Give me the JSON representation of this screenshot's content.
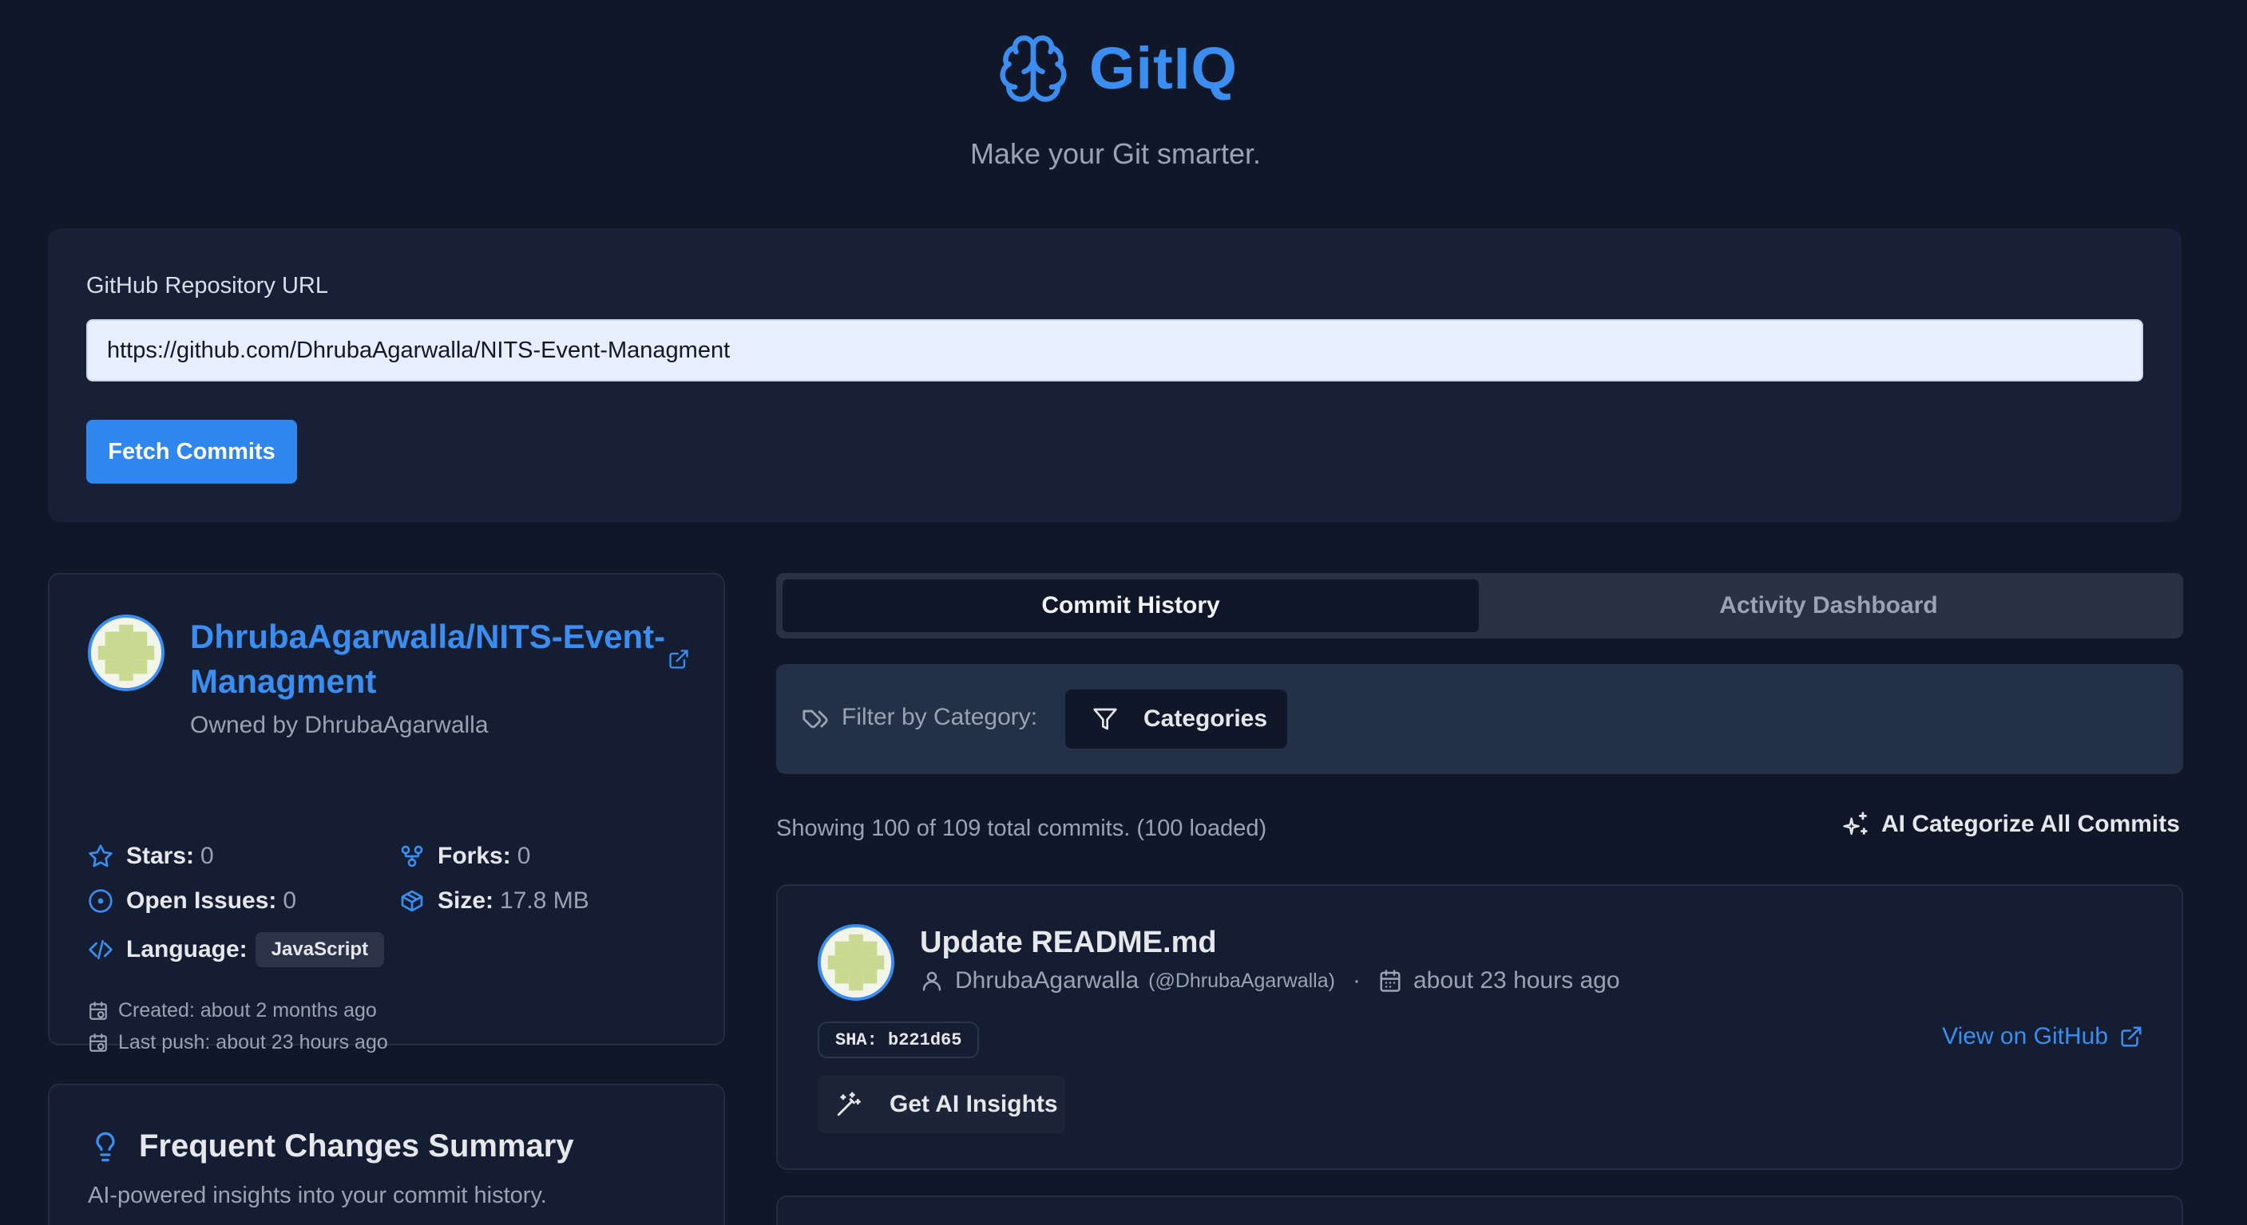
{
  "app": {
    "title": "GitIQ",
    "tagline": "Make your Git smarter.",
    "brand_color": "#3b8ef0",
    "logo_icon": "brain-icon"
  },
  "url_form": {
    "label": "GitHub Repository URL",
    "value": "https://github.com/DhrubaAgarwalla/NITS-Event-Managment",
    "submit_label": "Fetch Commits"
  },
  "repo": {
    "name": "DhrubaAgarwalla/NITS-Event-Managment",
    "owner_text": "Owned by DhrubaAgarwalla",
    "stats": {
      "stars_label": "Stars:",
      "stars_value": "0",
      "forks_label": "Forks:",
      "forks_value": "0",
      "issues_label": "Open Issues:",
      "issues_value": "0",
      "size_label": "Size:",
      "size_value": "17.8 MB",
      "language_label": "Language:",
      "language_value": "JavaScript"
    },
    "created": "Created: about 2 months ago",
    "last_push": "Last push: about 23 hours ago"
  },
  "summary": {
    "title": "Frequent Changes Summary",
    "subtitle": "AI-powered insights into your commit history."
  },
  "tabs": [
    {
      "label": "Commit History",
      "active": true
    },
    {
      "label": "Activity Dashboard",
      "active": false
    }
  ],
  "filter": {
    "label": "Filter by Category:",
    "button_label": "Categories"
  },
  "commits_info": {
    "showing_text": "Showing 100 of 109 total commits. (100 loaded)",
    "ai_categorize_label": "AI Categorize All Commits"
  },
  "commits": [
    {
      "title": "Update README.md",
      "author": "DhrubaAgarwalla",
      "handle": "(@DhrubaAgarwalla)",
      "separator": "·",
      "time": "about 23 hours ago",
      "sha": "SHA: b221d65",
      "view_label": "View on GitHub",
      "insights_label": "Get AI Insights"
    }
  ]
}
